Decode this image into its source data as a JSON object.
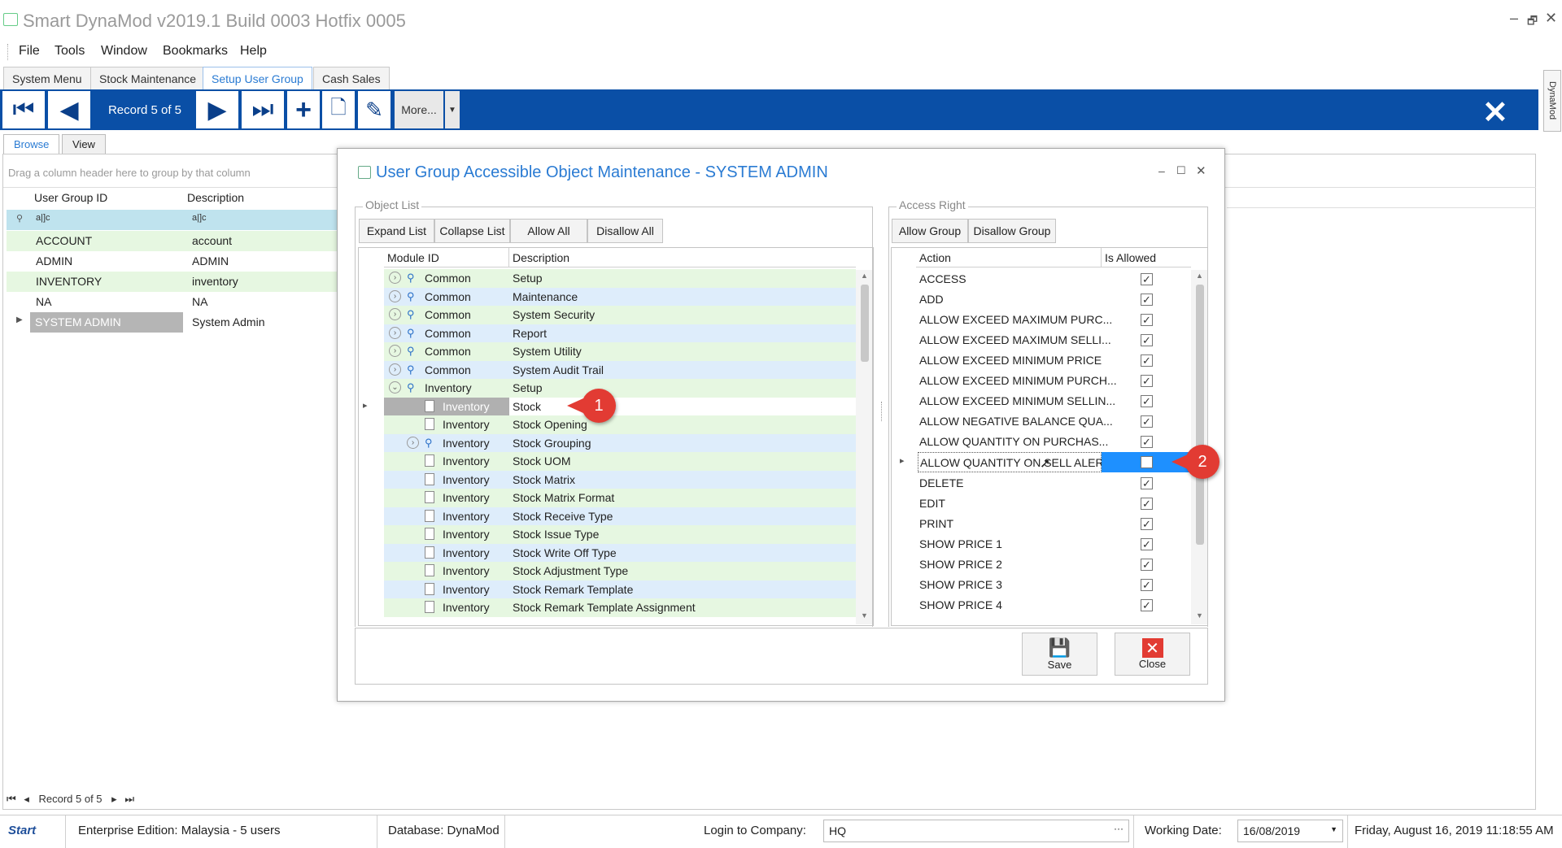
{
  "window": {
    "title": "Smart DynaMod v2019.1 Build 0003 Hotfix 0005",
    "controls": [
      "–",
      "🗗",
      "✕"
    ]
  },
  "menu": [
    "File",
    "Tools",
    "Window",
    "Bookmarks",
    "Help"
  ],
  "doc_tabs": [
    "System Menu",
    "Stock Maintenance",
    "Setup User Group",
    "Cash Sales"
  ],
  "active_doc_tab": "Setup User Group",
  "toolbar": {
    "record": "Record 5 of 5",
    "more": "More...",
    "side_tab": "DynaMod"
  },
  "view_tabs": [
    "Browse",
    "View"
  ],
  "browse": {
    "group_hint": "Drag a column header here to group by that column",
    "columns": [
      "User Group ID",
      "Description"
    ],
    "filter": [
      "a|]c",
      "a|]c"
    ],
    "rows": [
      {
        "id": "ACCOUNT",
        "desc": "account"
      },
      {
        "id": "ADMIN",
        "desc": "ADMIN"
      },
      {
        "id": "INVENTORY",
        "desc": "inventory"
      },
      {
        "id": "NA",
        "desc": "NA"
      },
      {
        "id": "SYSTEM ADMIN",
        "desc": "System Admin"
      }
    ],
    "nav": "Record 5 of 5"
  },
  "dialog": {
    "title": "User Group Accessible Object Maintenance - SYSTEM ADMIN",
    "object_list": {
      "label": "Object List",
      "buttons": [
        "Expand List",
        "Collapse List",
        "Allow All",
        "Disallow All"
      ],
      "columns": [
        "Module ID",
        "Description"
      ],
      "rows": [
        {
          "module": "Common",
          "desc": "Setup",
          "kind": "group"
        },
        {
          "module": "Common",
          "desc": "Maintenance",
          "kind": "group"
        },
        {
          "module": "Common",
          "desc": "System Security",
          "kind": "group"
        },
        {
          "module": "Common",
          "desc": "Report",
          "kind": "group"
        },
        {
          "module": "Common",
          "desc": "System Utility",
          "kind": "group"
        },
        {
          "module": "Common",
          "desc": "System Audit Trail",
          "kind": "group"
        },
        {
          "module": "Inventory",
          "desc": "Setup",
          "kind": "open"
        },
        {
          "module": "Inventory",
          "desc": "Stock",
          "kind": "selected"
        },
        {
          "module": "Inventory",
          "desc": "Stock Opening",
          "kind": "doc"
        },
        {
          "module": "Inventory",
          "desc": "Stock Grouping",
          "kind": "subgroup"
        },
        {
          "module": "Inventory",
          "desc": "Stock UOM",
          "kind": "doc"
        },
        {
          "module": "Inventory",
          "desc": "Stock Matrix",
          "kind": "doc"
        },
        {
          "module": "Inventory",
          "desc": "Stock Matrix Format",
          "kind": "doc"
        },
        {
          "module": "Inventory",
          "desc": "Stock Receive Type",
          "kind": "doc"
        },
        {
          "module": "Inventory",
          "desc": "Stock Issue Type",
          "kind": "doc"
        },
        {
          "module": "Inventory",
          "desc": "Stock Write Off Type",
          "kind": "doc"
        },
        {
          "module": "Inventory",
          "desc": "Stock Adjustment Type",
          "kind": "doc"
        },
        {
          "module": "Inventory",
          "desc": "Stock Remark Template",
          "kind": "doc"
        },
        {
          "module": "Inventory",
          "desc": "Stock Remark Template Assignment",
          "kind": "doc"
        }
      ]
    },
    "access_right": {
      "label": "Access Right",
      "buttons": [
        "Allow Group",
        "Disallow Group"
      ],
      "columns": [
        "Action",
        "Is Allowed"
      ],
      "rows": [
        {
          "action": "ACCESS",
          "allowed": true
        },
        {
          "action": "ADD",
          "allowed": true
        },
        {
          "action": "ALLOW EXCEED MAXIMUM PURC...",
          "allowed": true
        },
        {
          "action": "ALLOW EXCEED MAXIMUM SELLI...",
          "allowed": true
        },
        {
          "action": "ALLOW EXCEED MINIMUM PRICE",
          "allowed": true
        },
        {
          "action": "ALLOW EXCEED MINIMUM PURCH...",
          "allowed": true
        },
        {
          "action": "ALLOW EXCEED MINIMUM SELLIN...",
          "allowed": true
        },
        {
          "action": "ALLOW NEGATIVE BALANCE QUA...",
          "allowed": true
        },
        {
          "action": "ALLOW QUANTITY ON PURCHAS...",
          "allowed": true
        },
        {
          "action": "ALLOW QUANTITY ON SELL ALER...",
          "allowed": false
        },
        {
          "action": "DELETE",
          "allowed": true
        },
        {
          "action": "EDIT",
          "allowed": true
        },
        {
          "action": "PRINT",
          "allowed": true
        },
        {
          "action": "SHOW PRICE 1",
          "allowed": true
        },
        {
          "action": "SHOW PRICE 2",
          "allowed": true
        },
        {
          "action": "SHOW PRICE 3",
          "allowed": true
        },
        {
          "action": "SHOW PRICE 4",
          "allowed": true
        }
      ]
    },
    "save": "Save",
    "close": "Close",
    "callouts": [
      "1",
      "2"
    ]
  },
  "status": {
    "start": "Start",
    "edition": "Enterprise Edition: Malaysia - 5 users",
    "database": "Database: DynaMod",
    "login_label": "Login to Company:",
    "company": "HQ",
    "working_label": "Working Date:",
    "working_date": "16/08/2019",
    "datetime": "Friday, August 16, 2019 11:18:55 AM"
  },
  "colors": {
    "accent": "#0a4fa6",
    "link": "#2a7bd3",
    "callout": "#e23b33",
    "row_green": "#e6f7e1",
    "row_blue": "#deedfb"
  }
}
